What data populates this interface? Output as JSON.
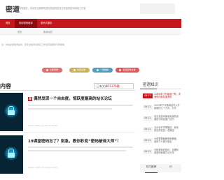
{
  "header": {
    "logo": "密道",
    "tagline": "密码服务，系统安全保障的密码是保障您安全的保障密码网络工作室"
  },
  "nav": {
    "items": [
      {
        "label": "首页"
      },
      {
        "label": "常用密码破译"
      },
      {
        "label": "密码式服务"
      }
    ]
  },
  "subnav": {
    "items": [
      {
        "label": "首页"
      },
      {
        "label": "新闻动态"
      }
    ]
  },
  "notice": "注：本站全部免费提供，若无法使用请联系工作室获取服务与帮助等",
  "actions": [
    {
      "label": "立即登录",
      "color": "#e36c70"
    },
    {
      "label": "免费注册",
      "color": "#c9b25b"
    },
    {
      "label": "一键破解",
      "color": "#4f9fbd"
    },
    {
      "label": "投稿密码文章",
      "color": "#e2575c"
    }
  ],
  "content": {
    "section_title": "内容",
    "updates_prefix": "已有文章",
    "updates_count": "51276篇"
  },
  "articles": [
    {
      "badge": "荐",
      "title": "偶然发现一个自由度，惊跃度最高的站长论坛",
      "meta": "admin    2021-11-16 12:33:53"
    },
    {
      "badge": "",
      "title": "19课堂密码忘了？别急，教你秒变“密码破译大师”！",
      "meta": "admin    2021-11-16 12:33:53"
    }
  ],
  "sidebar": {
    "title": "密语知识",
    "items": [
      {
        "date": "08-13",
        "text": "12年6年了只能改门号，手速快的朋友速来抢",
        "active": true
      },
      {
        "date": "08-12",
        "text": "2022年下半场网站可以开始做的几个方向，分享"
      },
      {
        "date": "08-12",
        "text": "站长是如何使用免费的资源进行网站推广技巧"
      },
      {
        "date": "08-12",
        "text": "五月份开学季赠送，原来是这样说的一些原因"
      },
      {
        "date": "08-12",
        "text": "大佬整理破解密码教程，适用于大部分朋友"
      },
      {
        "date": "08-12",
        "text": "过程更美好如何，合理利用密码管理方法分享"
      }
    ],
    "bottom_tabs": [
      "热门推荐",
      "精"
    ]
  }
}
